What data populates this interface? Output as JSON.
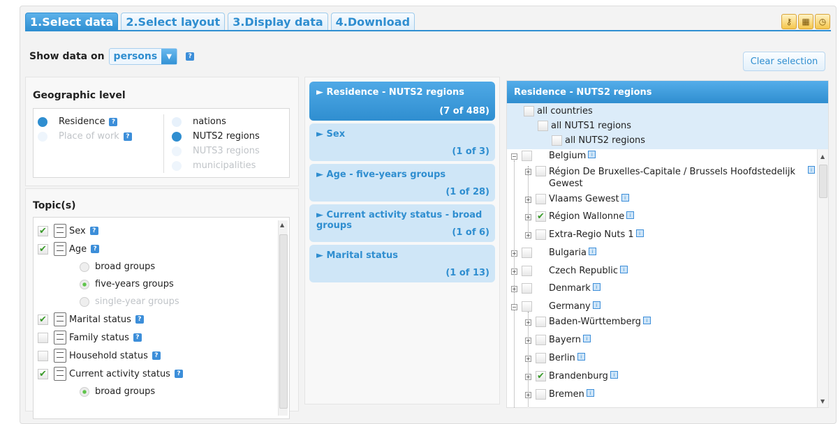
{
  "tabs": [
    {
      "label": "1.Select data",
      "active": true
    },
    {
      "label": "2.Select layout",
      "active": false
    },
    {
      "label": "3.Display data",
      "active": false
    },
    {
      "label": "4.Download",
      "active": false
    }
  ],
  "tool_icons": [
    "key-icon",
    "table-icon",
    "clock-icon"
  ],
  "show_data": {
    "label": "Show data on",
    "selected": "persons",
    "help": "?"
  },
  "clear_selection": "Clear selection",
  "geographic_level": {
    "title": "Geographic level",
    "left": [
      {
        "label": "Residence",
        "state": "on",
        "help": "?"
      },
      {
        "label": "Place of work",
        "state": "disabled",
        "help": "?"
      }
    ],
    "right": [
      {
        "label": "nations",
        "state": "off"
      },
      {
        "label": "NUTS2 regions",
        "state": "on"
      },
      {
        "label": "NUTS3 regions",
        "state": "disabled"
      },
      {
        "label": "municipalities",
        "state": "disabled"
      }
    ]
  },
  "topics": {
    "title": "Topic(s)",
    "items": [
      {
        "label": "Sex",
        "checked": true,
        "help": "?"
      },
      {
        "label": "Age",
        "checked": true,
        "help": "?"
      },
      {
        "label": "broad groups",
        "sub": true,
        "state": "off"
      },
      {
        "label": "five-years groups",
        "sub": true,
        "state": "on"
      },
      {
        "label": "single-year groups",
        "sub": true,
        "state": "disabled"
      },
      {
        "label": "Marital status",
        "checked": true,
        "help": "?"
      },
      {
        "label": "Family status",
        "checked": false,
        "help": "?"
      },
      {
        "label": "Household status",
        "checked": false,
        "help": "?"
      },
      {
        "label": "Current activity status",
        "checked": true,
        "help": "?"
      },
      {
        "label": "broad groups",
        "sub": true,
        "state": "on"
      }
    ]
  },
  "accordion": [
    {
      "title": "► Residence - NUTS2 regions",
      "count": "(7 of 488)",
      "active": true
    },
    {
      "title": "► Sex",
      "count": "(1 of 3)",
      "active": false
    },
    {
      "title": "► Age - five-years groups",
      "count": "(1 of 28)",
      "active": false
    },
    {
      "title": "► Current activity status - broad groups",
      "count": "(1 of 6)",
      "active": false
    },
    {
      "title": "► Marital status",
      "count": "(1 of 13)",
      "active": false
    }
  ],
  "region_panel": {
    "title": "Residence - NUTS2 regions",
    "all_countries": "all countries",
    "all_nuts1": "all NUTS1 regions",
    "all_nuts2": "all NUTS2 regions",
    "tree": [
      {
        "label": "Belgium",
        "level": 0,
        "expanded": true,
        "checked": false
      },
      {
        "label": "Région De Bruxelles-Capitale / Brussels Hoofdstedelijk Gewest",
        "level": 1,
        "checked": false
      },
      {
        "label": "Vlaams Gewest",
        "level": 1,
        "checked": false
      },
      {
        "label": "Région Wallonne",
        "level": 1,
        "checked": true
      },
      {
        "label": "Extra-Regio Nuts 1",
        "level": 1,
        "checked": false
      },
      {
        "label": "Bulgaria",
        "level": 0,
        "checked": false
      },
      {
        "label": "Czech Republic",
        "level": 0,
        "checked": false
      },
      {
        "label": "Denmark",
        "level": 0,
        "checked": false
      },
      {
        "label": "Germany",
        "level": 0,
        "expanded": true,
        "checked": false
      },
      {
        "label": "Baden-Württemberg",
        "level": 1,
        "checked": false
      },
      {
        "label": "Bayern",
        "level": 1,
        "checked": false
      },
      {
        "label": "Berlin",
        "level": 1,
        "checked": false
      },
      {
        "label": "Brandenburg",
        "level": 1,
        "checked": true
      },
      {
        "label": "Bremen",
        "level": 1,
        "checked": false
      }
    ]
  }
}
